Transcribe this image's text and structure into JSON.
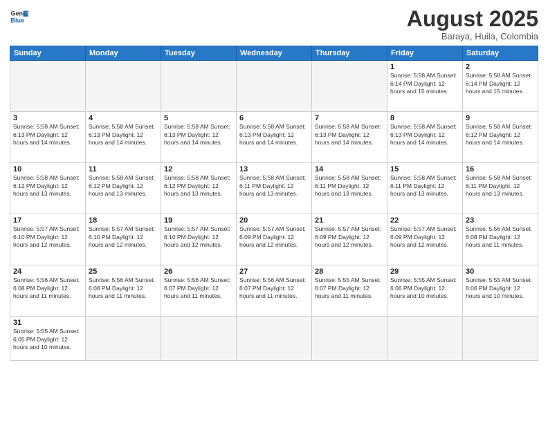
{
  "header": {
    "logo_general": "General",
    "logo_blue": "Blue",
    "month_title": "August 2025",
    "location": "Baraya, Huila, Colombia"
  },
  "weekdays": [
    "Sunday",
    "Monday",
    "Tuesday",
    "Wednesday",
    "Thursday",
    "Friday",
    "Saturday"
  ],
  "weeks": [
    [
      {
        "day": "",
        "info": ""
      },
      {
        "day": "",
        "info": ""
      },
      {
        "day": "",
        "info": ""
      },
      {
        "day": "",
        "info": ""
      },
      {
        "day": "",
        "info": ""
      },
      {
        "day": "1",
        "info": "Sunrise: 5:58 AM\nSunset: 6:14 PM\nDaylight: 12 hours\nand 15 minutes."
      },
      {
        "day": "2",
        "info": "Sunrise: 5:58 AM\nSunset: 6:14 PM\nDaylight: 12 hours\nand 15 minutes."
      }
    ],
    [
      {
        "day": "3",
        "info": "Sunrise: 5:58 AM\nSunset: 6:13 PM\nDaylight: 12 hours\nand 14 minutes."
      },
      {
        "day": "4",
        "info": "Sunrise: 5:58 AM\nSunset: 6:13 PM\nDaylight: 12 hours\nand 14 minutes."
      },
      {
        "day": "5",
        "info": "Sunrise: 5:58 AM\nSunset: 6:13 PM\nDaylight: 12 hours\nand 14 minutes."
      },
      {
        "day": "6",
        "info": "Sunrise: 5:58 AM\nSunset: 6:13 PM\nDaylight: 12 hours\nand 14 minutes."
      },
      {
        "day": "7",
        "info": "Sunrise: 5:58 AM\nSunset: 6:13 PM\nDaylight: 12 hours\nand 14 minutes."
      },
      {
        "day": "8",
        "info": "Sunrise: 5:58 AM\nSunset: 6:13 PM\nDaylight: 12 hours\nand 14 minutes."
      },
      {
        "day": "9",
        "info": "Sunrise: 5:58 AM\nSunset: 6:12 PM\nDaylight: 12 hours\nand 14 minutes."
      }
    ],
    [
      {
        "day": "10",
        "info": "Sunrise: 5:58 AM\nSunset: 6:12 PM\nDaylight: 12 hours\nand 13 minutes."
      },
      {
        "day": "11",
        "info": "Sunrise: 5:58 AM\nSunset: 6:12 PM\nDaylight: 12 hours\nand 13 minutes."
      },
      {
        "day": "12",
        "info": "Sunrise: 5:58 AM\nSunset: 6:12 PM\nDaylight: 12 hours\nand 13 minutes."
      },
      {
        "day": "13",
        "info": "Sunrise: 5:58 AM\nSunset: 6:11 PM\nDaylight: 12 hours\nand 13 minutes."
      },
      {
        "day": "14",
        "info": "Sunrise: 5:58 AM\nSunset: 6:11 PM\nDaylight: 12 hours\nand 13 minutes."
      },
      {
        "day": "15",
        "info": "Sunrise: 5:58 AM\nSunset: 6:11 PM\nDaylight: 12 hours\nand 13 minutes."
      },
      {
        "day": "16",
        "info": "Sunrise: 5:58 AM\nSunset: 6:11 PM\nDaylight: 12 hours\nand 13 minutes."
      }
    ],
    [
      {
        "day": "17",
        "info": "Sunrise: 5:57 AM\nSunset: 6:10 PM\nDaylight: 12 hours\nand 12 minutes."
      },
      {
        "day": "18",
        "info": "Sunrise: 5:57 AM\nSunset: 6:10 PM\nDaylight: 12 hours\nand 12 minutes."
      },
      {
        "day": "19",
        "info": "Sunrise: 5:57 AM\nSunset: 6:10 PM\nDaylight: 12 hours\nand 12 minutes."
      },
      {
        "day": "20",
        "info": "Sunrise: 5:57 AM\nSunset: 6:09 PM\nDaylight: 12 hours\nand 12 minutes."
      },
      {
        "day": "21",
        "info": "Sunrise: 5:57 AM\nSunset: 6:09 PM\nDaylight: 12 hours\nand 12 minutes."
      },
      {
        "day": "22",
        "info": "Sunrise: 5:57 AM\nSunset: 6:09 PM\nDaylight: 12 hours\nand 12 minutes."
      },
      {
        "day": "23",
        "info": "Sunrise: 5:56 AM\nSunset: 6:08 PM\nDaylight: 12 hours\nand 11 minutes."
      }
    ],
    [
      {
        "day": "24",
        "info": "Sunrise: 5:56 AM\nSunset: 6:08 PM\nDaylight: 12 hours\nand 11 minutes."
      },
      {
        "day": "25",
        "info": "Sunrise: 5:56 AM\nSunset: 6:08 PM\nDaylight: 12 hours\nand 11 minutes."
      },
      {
        "day": "26",
        "info": "Sunrise: 5:56 AM\nSunset: 6:07 PM\nDaylight: 12 hours\nand 11 minutes."
      },
      {
        "day": "27",
        "info": "Sunrise: 5:56 AM\nSunset: 6:07 PM\nDaylight: 12 hours\nand 11 minutes."
      },
      {
        "day": "28",
        "info": "Sunrise: 5:55 AM\nSunset: 6:07 PM\nDaylight: 12 hours\nand 11 minutes."
      },
      {
        "day": "29",
        "info": "Sunrise: 5:55 AM\nSunset: 6:06 PM\nDaylight: 12 hours\nand 10 minutes."
      },
      {
        "day": "30",
        "info": "Sunrise: 5:55 AM\nSunset: 6:06 PM\nDaylight: 12 hours\nand 10 minutes."
      }
    ],
    [
      {
        "day": "31",
        "info": "Sunrise: 5:55 AM\nSunset: 6:05 PM\nDaylight: 12 hours\nand 10 minutes."
      },
      {
        "day": "",
        "info": ""
      },
      {
        "day": "",
        "info": ""
      },
      {
        "day": "",
        "info": ""
      },
      {
        "day": "",
        "info": ""
      },
      {
        "day": "",
        "info": ""
      },
      {
        "day": "",
        "info": ""
      }
    ]
  ]
}
